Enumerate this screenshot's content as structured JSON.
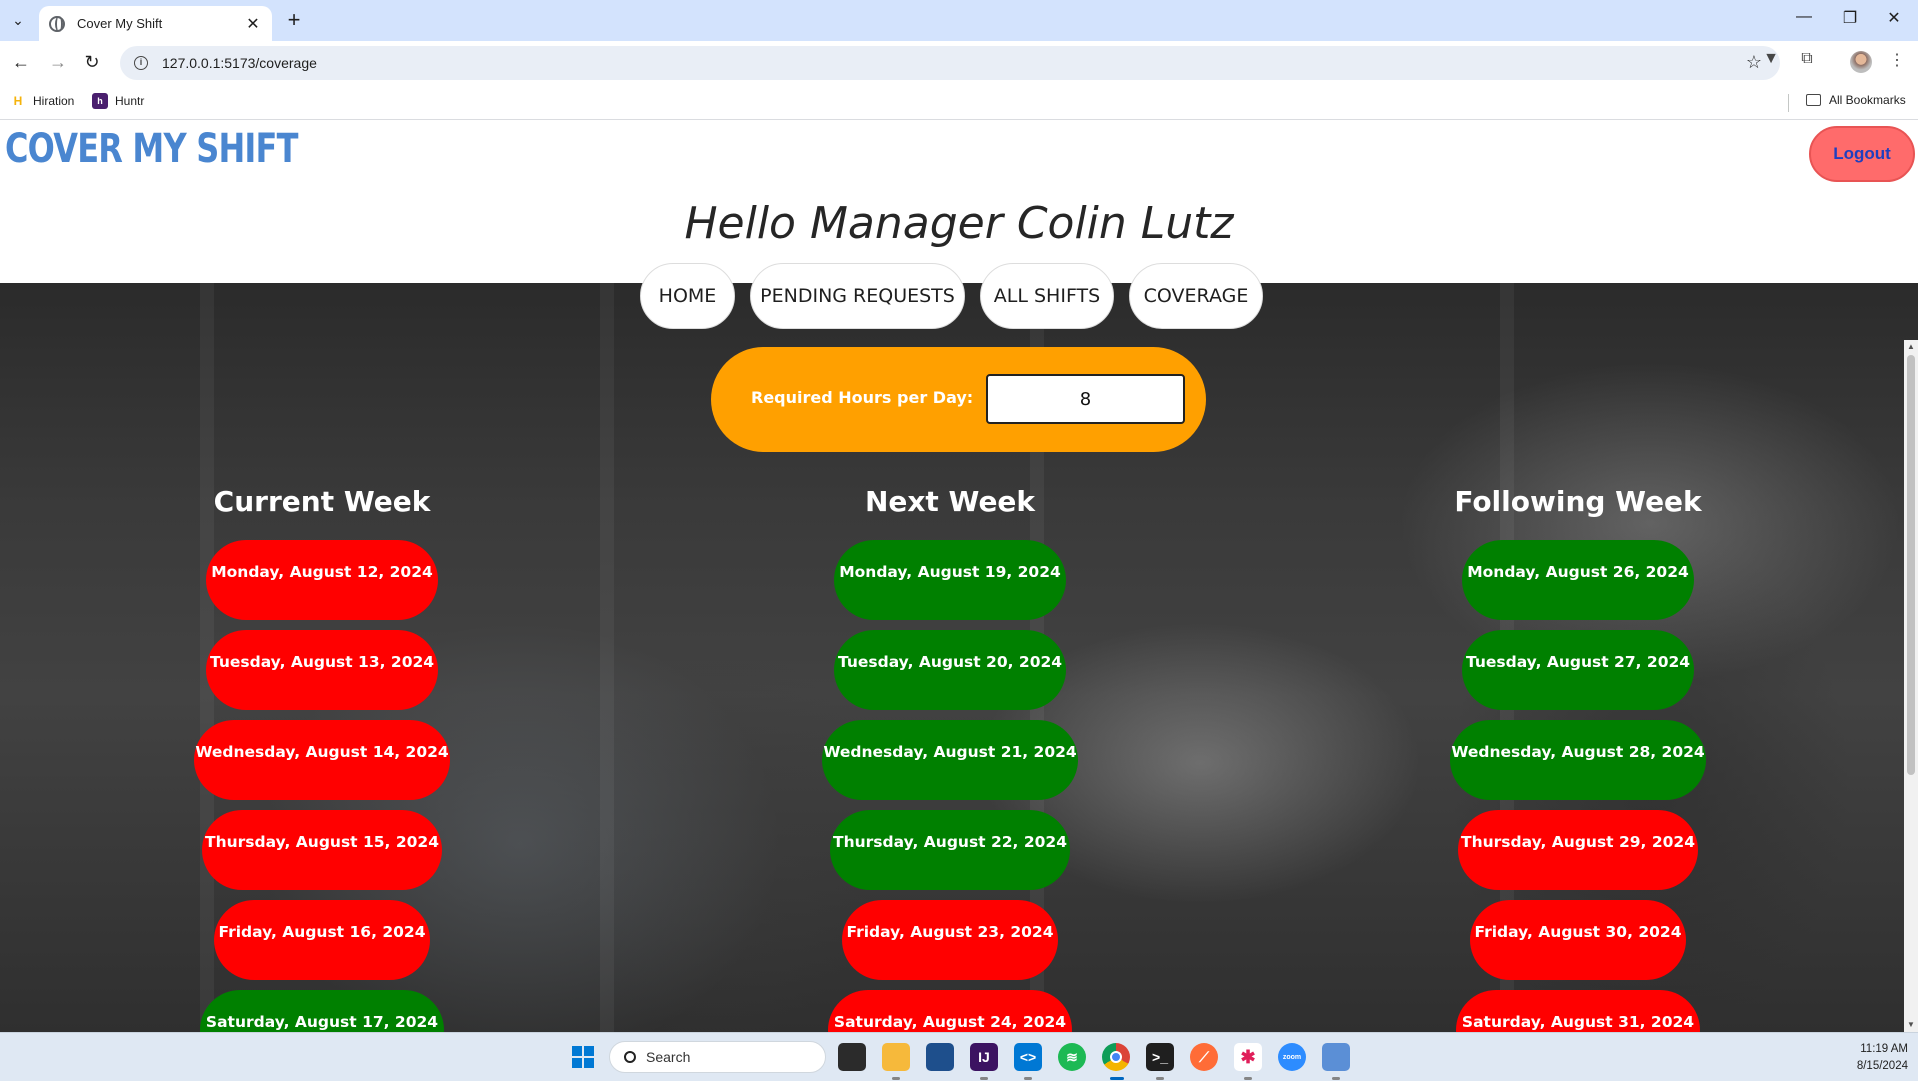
{
  "browser": {
    "tab_title": "Cover My Shift",
    "url": "127.0.0.1:5173/coverage",
    "bookmarks": [
      {
        "label": "Hiration",
        "icon": "H"
      },
      {
        "label": "Huntr",
        "icon": "h"
      }
    ],
    "all_bookmarks_label": "All Bookmarks"
  },
  "app": {
    "brand": "COVER MY SHIFT",
    "logout_label": "Logout",
    "greeting": "Hello Manager Colin Lutz",
    "nav": [
      "HOME",
      "PENDING REQUESTS",
      "ALL SHIFTS",
      "COVERAGE"
    ],
    "hours_label": "Required Hours per Day:",
    "hours_value": "8"
  },
  "weeks": [
    {
      "title": "Current Week",
      "days": [
        {
          "label": "Monday, August 12, 2024",
          "status": "red"
        },
        {
          "label": "Tuesday, August 13, 2024",
          "status": "red"
        },
        {
          "label": "Wednesday, August 14, 2024",
          "status": "red"
        },
        {
          "label": "Thursday, August 15, 2024",
          "status": "red"
        },
        {
          "label": "Friday, August 16, 2024",
          "status": "red"
        },
        {
          "label": "Saturday, August 17, 2024",
          "status": "green"
        }
      ]
    },
    {
      "title": "Next Week",
      "days": [
        {
          "label": "Monday, August 19, 2024",
          "status": "green"
        },
        {
          "label": "Tuesday, August 20, 2024",
          "status": "green"
        },
        {
          "label": "Wednesday, August 21, 2024",
          "status": "green"
        },
        {
          "label": "Thursday, August 22, 2024",
          "status": "green"
        },
        {
          "label": "Friday, August 23, 2024",
          "status": "red"
        },
        {
          "label": "Saturday, August 24, 2024",
          "status": "red"
        }
      ]
    },
    {
      "title": "Following Week",
      "days": [
        {
          "label": "Monday, August 26, 2024",
          "status": "green"
        },
        {
          "label": "Tuesday, August 27, 2024",
          "status": "green"
        },
        {
          "label": "Wednesday, August 28, 2024",
          "status": "green"
        },
        {
          "label": "Thursday, August 29, 2024",
          "status": "red"
        },
        {
          "label": "Friday, August 30, 2024",
          "status": "red"
        },
        {
          "label": "Saturday, August 31, 2024",
          "status": "red"
        }
      ]
    }
  ],
  "colors": {
    "red": "#ff0000",
    "green": "#008000",
    "brand": "#4a86d0",
    "hours_box": "#ffa000",
    "logout": "#ff6b6b"
  },
  "taskbar": {
    "search_placeholder": "Search",
    "time": "11:19 AM",
    "date": "8/15/2024",
    "apps": [
      "windows-start-icon",
      "task-view-icon",
      "file-explorer-icon",
      "microsoft-store-icon",
      "intellij-icon",
      "vscode-icon",
      "spotify-icon",
      "chrome-icon",
      "terminal-icon",
      "postman-icon",
      "slack-icon",
      "zoom-icon",
      "notepad-icon"
    ]
  }
}
